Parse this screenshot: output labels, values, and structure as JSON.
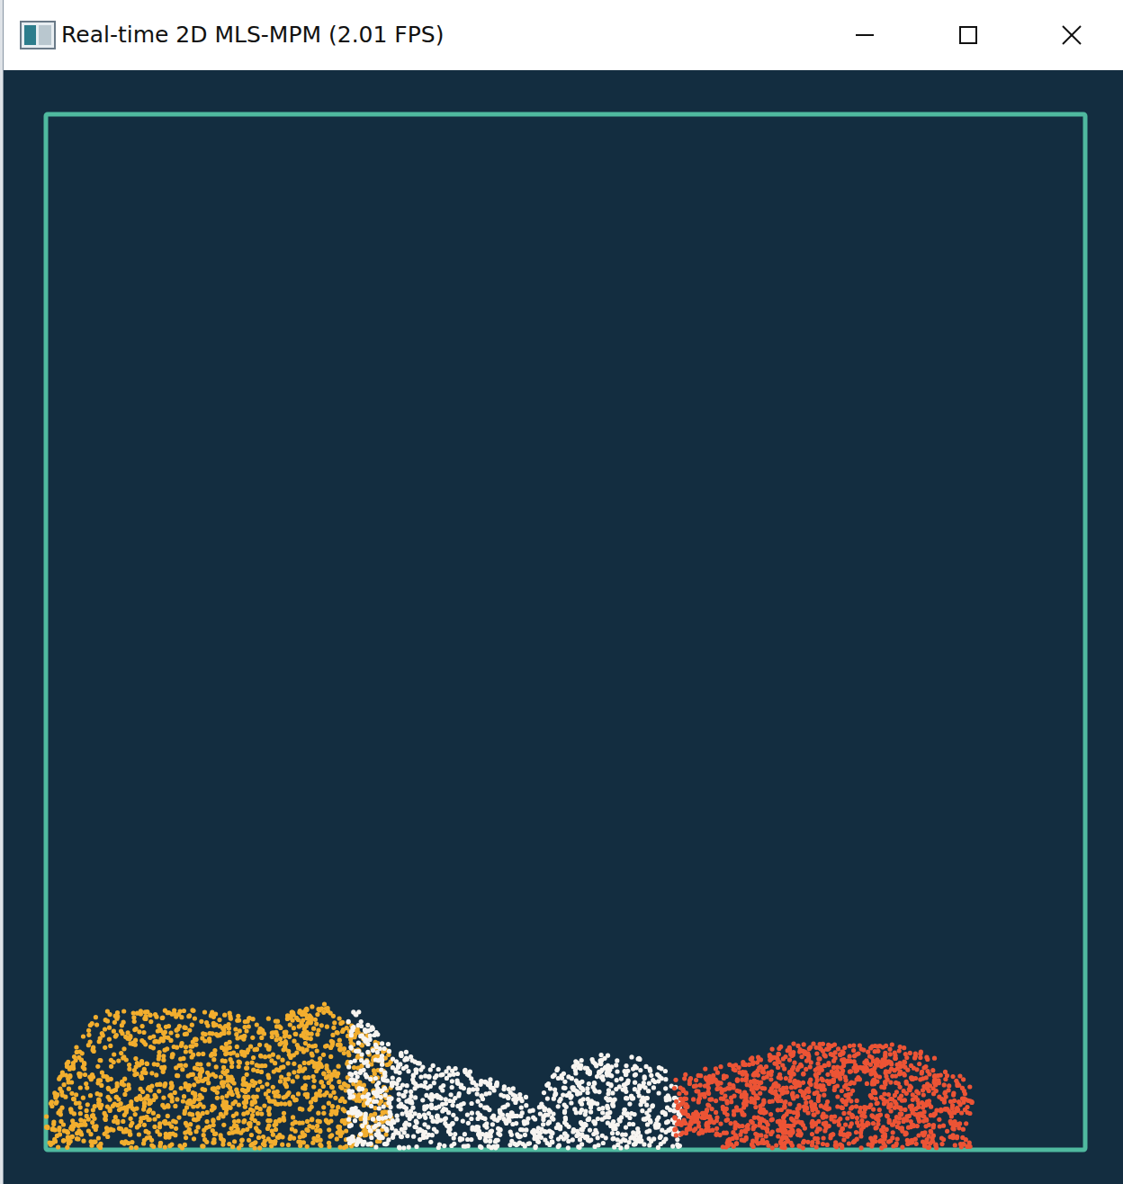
{
  "window": {
    "title": "Real-time 2D MLS-MPM (2.01 FPS)"
  },
  "particles": [
    {
      "color": "#f2ae2e"
    },
    {
      "color": "#f7f4f0"
    },
    {
      "color": "#ec5435"
    }
  ]
}
